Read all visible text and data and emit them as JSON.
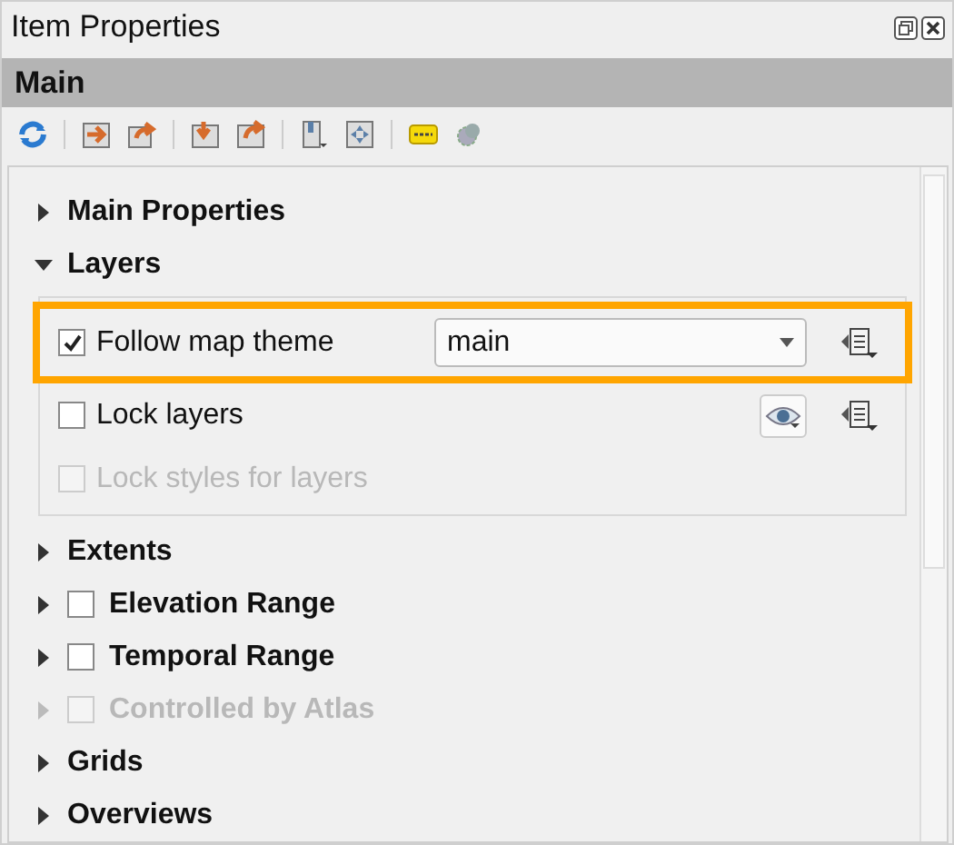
{
  "window": {
    "title": "Item Properties"
  },
  "panel": {
    "title": "Main"
  },
  "sections": [
    {
      "kind": "plain",
      "label": "Main Properties",
      "expanded": false,
      "disabled": false
    },
    {
      "kind": "plain",
      "label": "Layers",
      "expanded": true,
      "disabled": false,
      "rows": [
        {
          "kind": "theme",
          "label": "Follow map theme",
          "checked": true,
          "disabled": false,
          "highlighted": true,
          "value": "main"
        },
        {
          "kind": "lock",
          "label": "Lock layers",
          "checked": false,
          "disabled": false,
          "highlighted": false
        },
        {
          "kind": "check",
          "label": "Lock styles for layers",
          "checked": false,
          "disabled": true,
          "highlighted": false
        }
      ]
    },
    {
      "kind": "plain",
      "label": "Extents",
      "expanded": false,
      "disabled": false
    },
    {
      "kind": "checkable",
      "label": "Elevation Range",
      "expanded": false,
      "disabled": false,
      "checked": false
    },
    {
      "kind": "checkable",
      "label": "Temporal Range",
      "expanded": false,
      "disabled": false,
      "checked": false
    },
    {
      "kind": "checkable",
      "label": "Controlled by Atlas",
      "expanded": false,
      "disabled": true,
      "checked": false
    },
    {
      "kind": "plain",
      "label": "Grids",
      "expanded": false,
      "disabled": false
    },
    {
      "kind": "plain",
      "label": "Overviews",
      "expanded": false,
      "disabled": false
    }
  ]
}
